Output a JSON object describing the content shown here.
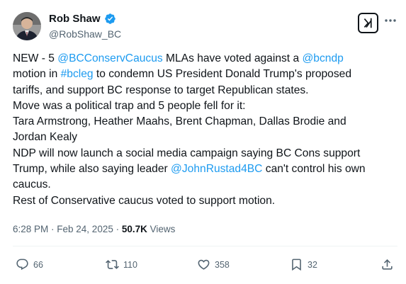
{
  "author": {
    "display_name": "Rob Shaw",
    "handle": "@RobShaw_BC",
    "verified": true
  },
  "tweet": {
    "lines": [
      [
        {
          "t": "NEW - 5 "
        },
        {
          "t": "@BCConservCaucus",
          "link": true
        },
        {
          "t": " MLAs have voted against a "
        },
        {
          "t": "@bcndp",
          "link": true
        }
      ],
      [
        {
          "t": "motion in "
        },
        {
          "t": "#bcleg",
          "link": true
        },
        {
          "t": " to condemn US President Donald Trump's proposed"
        }
      ],
      [
        {
          "t": "tariffs, and support BC response to target Republican states."
        }
      ],
      [
        {
          "t": "Move was a political trap and 5 people fell for it:"
        }
      ],
      [
        {
          "t": "Tara Armstrong, Heather Maahs, Brent Chapman, Dallas Brodie and"
        }
      ],
      [
        {
          "t": "Jordan Kealy"
        }
      ],
      [
        {
          "t": "NDP will now launch a social media campaign saying BC Cons support"
        }
      ],
      [
        {
          "t": "Trump, while also saying leader "
        },
        {
          "t": "@JohnRustad4BC",
          "link": true
        },
        {
          "t": " can't control his own"
        }
      ],
      [
        {
          "t": "caucus."
        }
      ],
      [
        {
          "t": "Rest of Conservative caucus voted to support motion."
        }
      ]
    ]
  },
  "meta": {
    "time": "6:28 PM",
    "separator": " · ",
    "date": "Feb 24, 2025",
    "separator2": " · ",
    "views_count": "50.7K",
    "views_label": " Views"
  },
  "actions": {
    "replies": "66",
    "reposts": "110",
    "likes": "358",
    "bookmarks": "32"
  },
  "colors": {
    "link": "#1d9bf0",
    "verified": "#1d9bf0",
    "secondary_text": "#536471",
    "primary_text": "#0f1419"
  },
  "icons": [
    "verified-badge-icon",
    "grok-icon",
    "more-icon",
    "reply-icon",
    "repost-icon",
    "like-icon",
    "bookmark-icon",
    "share-icon"
  ]
}
